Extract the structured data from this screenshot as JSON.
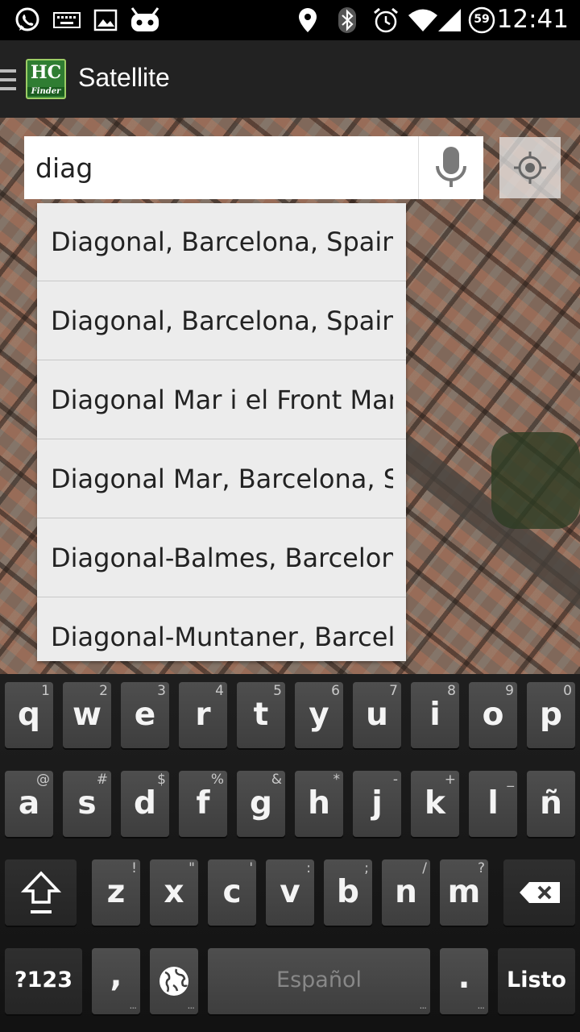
{
  "status_bar": {
    "time": "12:41",
    "battery_level": "59",
    "icons": [
      "whatsapp-icon",
      "keyboard-icon",
      "image-icon",
      "android-robot-icon",
      "location-icon",
      "bluetooth-icon",
      "alarm-icon",
      "wifi-icon",
      "signal-icon",
      "battery-icon"
    ]
  },
  "action_bar": {
    "logo_text": "HC",
    "logo_subtext": "Finder",
    "title": "Satellite"
  },
  "search": {
    "value": "diag"
  },
  "suggestions": [
    "Diagonal, Barcelona, Spain",
    "Diagonal, Barcelona, Spain",
    "Diagonal Mar i el Front Marítim del Poblenou",
    "Diagonal Mar, Barcelona, Spain",
    "Diagonal-Balmes, Barcelona, Spain",
    "Diagonal-Muntaner, Barcelona, Spain"
  ],
  "keyboard": {
    "row1": [
      {
        "key": "q",
        "hint": "1"
      },
      {
        "key": "w",
        "hint": "2"
      },
      {
        "key": "e",
        "hint": "3"
      },
      {
        "key": "r",
        "hint": "4"
      },
      {
        "key": "t",
        "hint": "5"
      },
      {
        "key": "y",
        "hint": "6"
      },
      {
        "key": "u",
        "hint": "7"
      },
      {
        "key": "i",
        "hint": "8"
      },
      {
        "key": "o",
        "hint": "9"
      },
      {
        "key": "p",
        "hint": "0"
      }
    ],
    "row2": [
      {
        "key": "a",
        "hint": "@"
      },
      {
        "key": "s",
        "hint": "#"
      },
      {
        "key": "d",
        "hint": "$"
      },
      {
        "key": "f",
        "hint": "%"
      },
      {
        "key": "g",
        "hint": "&"
      },
      {
        "key": "h",
        "hint": "*"
      },
      {
        "key": "j",
        "hint": "-"
      },
      {
        "key": "k",
        "hint": "+"
      },
      {
        "key": "l",
        "hint": "_"
      },
      {
        "key": "ñ",
        "hint": ""
      }
    ],
    "row3": [
      {
        "key": "z",
        "hint": "!"
      },
      {
        "key": "x",
        "hint": "\""
      },
      {
        "key": "c",
        "hint": "'"
      },
      {
        "key": "v",
        "hint": ":"
      },
      {
        "key": "b",
        "hint": ";"
      },
      {
        "key": "n",
        "hint": "/"
      },
      {
        "key": "m",
        "hint": "?"
      }
    ],
    "symbols_label": "?123",
    "comma_label": ",",
    "space_label": "Español",
    "period_label": ".",
    "done_label": "Listo"
  }
}
